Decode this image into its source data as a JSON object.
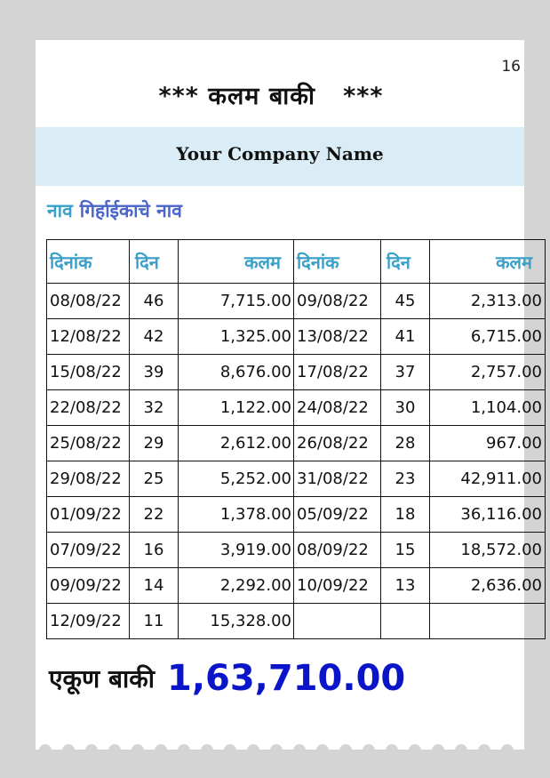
{
  "page_number": "16",
  "title": "*** कलम बाकी   ***",
  "company_name": "Your Company Name",
  "customer": {
    "label": "नाव",
    "name": "गिर्हाईकाचे नाव"
  },
  "columns": [
    "दिनांक",
    "दिन",
    "कलम",
    "दिनांक",
    "दिन",
    "कलम"
  ],
  "rows": [
    [
      "08/08/22",
      "46",
      "7,715.00",
      "09/08/22",
      "45",
      "2,313.00"
    ],
    [
      "12/08/22",
      "42",
      "1,325.00",
      "13/08/22",
      "41",
      "6,715.00"
    ],
    [
      "15/08/22",
      "39",
      "8,676.00",
      "17/08/22",
      "37",
      "2,757.00"
    ],
    [
      "22/08/22",
      "32",
      "1,122.00",
      "24/08/22",
      "30",
      "1,104.00"
    ],
    [
      "25/08/22",
      "29",
      "2,612.00",
      "26/08/22",
      "28",
      "967.00"
    ],
    [
      "29/08/22",
      "25",
      "5,252.00",
      "31/08/22",
      "23",
      "42,911.00"
    ],
    [
      "01/09/22",
      "22",
      "1,378.00",
      "05/09/22",
      "18",
      "36,116.00"
    ],
    [
      "07/09/22",
      "16",
      "3,919.00",
      "08/09/22",
      "15",
      "18,572.00"
    ],
    [
      "09/09/22",
      "14",
      "2,292.00",
      "10/09/22",
      "13",
      "2,636.00"
    ],
    [
      "12/09/22",
      "11",
      "15,328.00",
      "",
      "",
      ""
    ]
  ],
  "total": {
    "label": "एकूण बाकी",
    "value": "1,63,710.00"
  },
  "colors": {
    "header_text": "#3aa0c8",
    "customer_name": "#4a66c8",
    "total_value": "#0a14c8",
    "band": "#daedf7"
  }
}
